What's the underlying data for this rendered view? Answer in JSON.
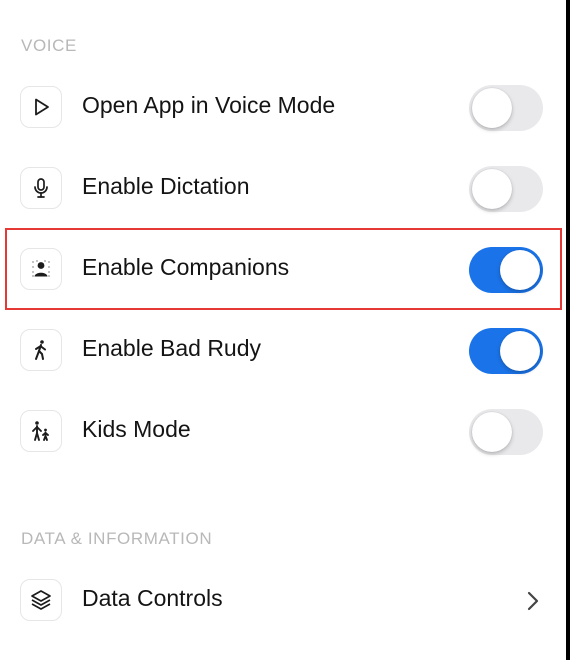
{
  "sections": {
    "voice": {
      "title": "VOICE"
    },
    "data_info": {
      "title": "DATA & INFORMATION"
    }
  },
  "rows": {
    "open_app_voice": {
      "label": "Open App in Voice Mode",
      "icon": "play-icon",
      "enabled": false
    },
    "dictation": {
      "label": "Enable Dictation",
      "icon": "microphone-icon",
      "enabled": false
    },
    "companions": {
      "label": "Enable Companions",
      "icon": "companion-avatar-icon",
      "enabled": true
    },
    "bad_rudy": {
      "label": "Enable Bad Rudy",
      "icon": "walking-person-icon",
      "enabled": true
    },
    "kids_mode": {
      "label": "Kids Mode",
      "icon": "parent-child-icon",
      "enabled": false
    },
    "data_controls": {
      "label": "Data Controls",
      "icon": "layers-icon"
    }
  },
  "colors": {
    "toggle_on": "#1a73e8",
    "toggle_off": "#e9e9eb",
    "highlight": "#e53935",
    "section_header": "#b8b8b8"
  }
}
